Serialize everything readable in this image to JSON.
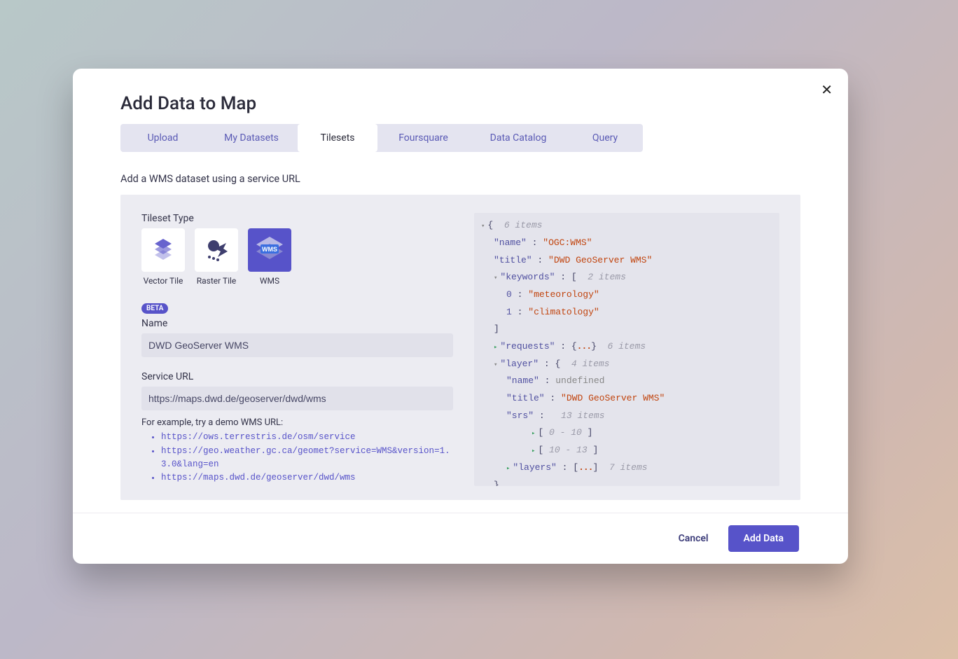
{
  "modal": {
    "title": "Add Data to Map",
    "subtitle": "Add a WMS dataset using a service URL"
  },
  "tabs": [
    "Upload",
    "My Datasets",
    "Tilesets",
    "Foursquare",
    "Data Catalog",
    "Query"
  ],
  "active_tab": "Tilesets",
  "tileset_type": {
    "label": "Tileset Type",
    "items": [
      {
        "label": "Vector Tile",
        "selected": false
      },
      {
        "label": "Raster Tile",
        "selected": false
      },
      {
        "label": "WMS",
        "selected": true
      }
    ]
  },
  "badge_text": "BETA",
  "name_field": {
    "label": "Name",
    "value": "DWD GeoServer WMS"
  },
  "service_url_field": {
    "label": "Service URL",
    "value": "https://maps.dwd.de/geoserver/dwd/wms"
  },
  "hint": {
    "text": "For example, try a demo WMS URL:",
    "urls": [
      "https://ows.terrestris.de/osm/service",
      "https://geo.weather.gc.ca/geomet?service=WMS&version=1.3.0&lang=en",
      "https://maps.dwd.de/geoserver/dwd/wms"
    ]
  },
  "json_preview": {
    "root_items": "6 items",
    "name": "OGC:WMS",
    "title": "DWD GeoServer WMS",
    "keywords_count": "2 items",
    "keywords": [
      "meteorology",
      "climatology"
    ],
    "requests_count": "6 items",
    "layer_count": "4 items",
    "layer_name": "undefined",
    "layer_title": "DWD GeoServer WMS",
    "srs_count": "13 items",
    "srs_range1": "0 - 10",
    "srs_range2": "10 - 13",
    "layers_count": "7 items"
  },
  "footer": {
    "cancel": "Cancel",
    "add": "Add Data"
  }
}
